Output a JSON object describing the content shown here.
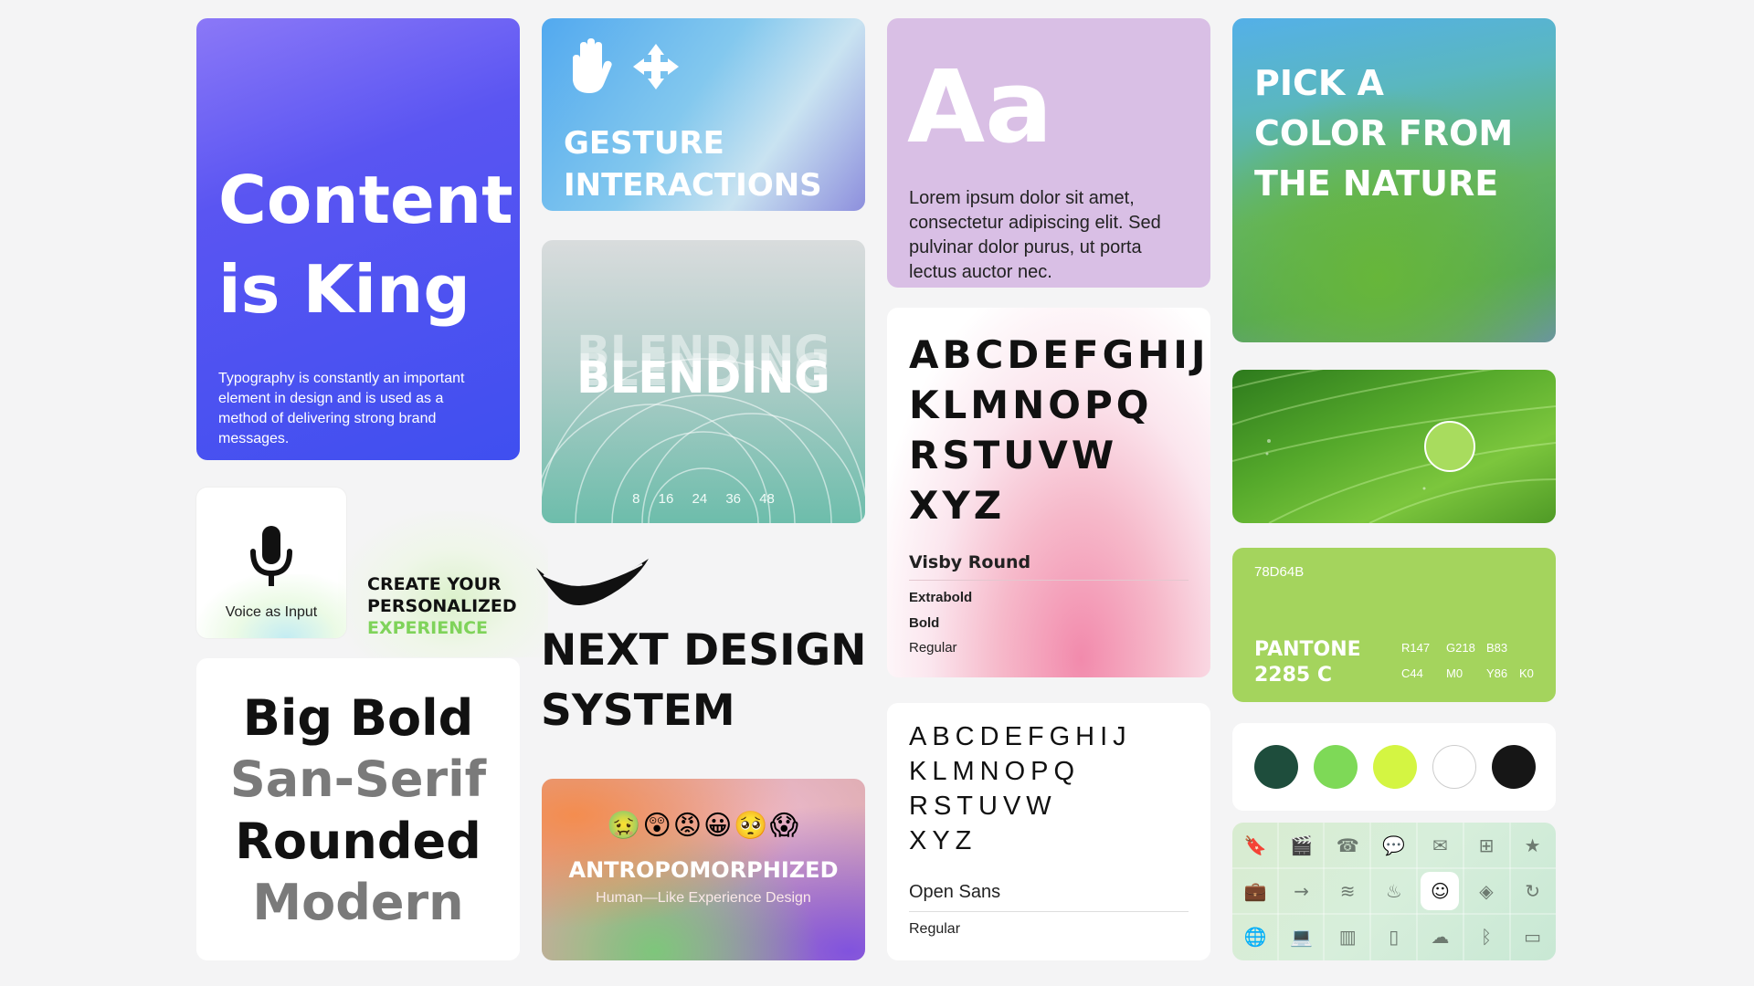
{
  "content_card": {
    "title": "Content\nis King",
    "body": "Typography is constantly an important element in design and is used as a method of delivering strong brand messages."
  },
  "gesture_card": {
    "title": "GESTURE\nINTERACTIONS",
    "icons": [
      "hand-icon",
      "move-arrows-icon"
    ]
  },
  "blending_card": {
    "word": "BLENDING",
    "ticks": [
      "8",
      "16",
      "24",
      "36",
      "48"
    ]
  },
  "aa_card": {
    "glyph": "Aa",
    "body": "Lorem ipsum dolor sit amet, consectetur adipiscing elit. Sed pulvinar dolor purus, ut porta lectus auctor nec."
  },
  "pick_card": {
    "title": "PICK A\nCOLOR FROM\nTHE NATURE"
  },
  "voice_card": {
    "label": "Voice as Input",
    "icon": "microphone-icon"
  },
  "personalized": {
    "line1": "CREATE YOUR",
    "line2": "PERSONALIZED",
    "line3": "EXPERIENCE"
  },
  "bigbold_card": {
    "lines": [
      "Big Bold",
      "San-Serif",
      "Rounded",
      "Modern"
    ]
  },
  "next_design": {
    "title": "NEXT DESIGN\nSYSTEM",
    "logo": "swoosh-logo"
  },
  "antro_card": {
    "emojis": "🤢😲😡😀🥺😱",
    "title": "ANTROPOMORPHIZED",
    "subtitle": "Human—Like Experience Design"
  },
  "visby_card": {
    "alphabet": "ABCDEFGHIJ\nKLMNOPQ\nRSTUVW\nXYZ",
    "font_name": "Visby Round",
    "weights": [
      "Extrabold",
      "Bold",
      "Regular"
    ]
  },
  "opensans_card": {
    "alphabet": "ABCDEFGHIJ\nKLMNOPQ\nRSTUVW\nXYZ",
    "font_name": "Open Sans",
    "weights": [
      "Regular"
    ]
  },
  "pantone_card": {
    "hex": "78D64B",
    "name": "PANTONE\n2285 C",
    "rgb": [
      "R147",
      "G218",
      "B83"
    ],
    "cmyk": [
      "C44",
      "M0",
      "Y86",
      "K0"
    ],
    "color": "#a4d45d"
  },
  "swatches": [
    "#1e4d3c",
    "#7ed957",
    "#d4f542",
    "#ffffff",
    "#161616"
  ],
  "icon_grid": [
    "bookmark-icon",
    "clapperboard-icon",
    "phone-icon",
    "chat-icon",
    "mail-icon",
    "add-box-icon",
    "star-icon",
    "briefcase-icon",
    "arrow-right-icon",
    "wifi-icon",
    "food-icon",
    "face-icon",
    "layers-icon",
    "refresh-icon",
    "globe-icon",
    "laptop-icon",
    "bar-chart-icon",
    "smartphone-icon",
    "cloud-icon",
    "bluetooth-icon",
    "credit-card-icon"
  ]
}
